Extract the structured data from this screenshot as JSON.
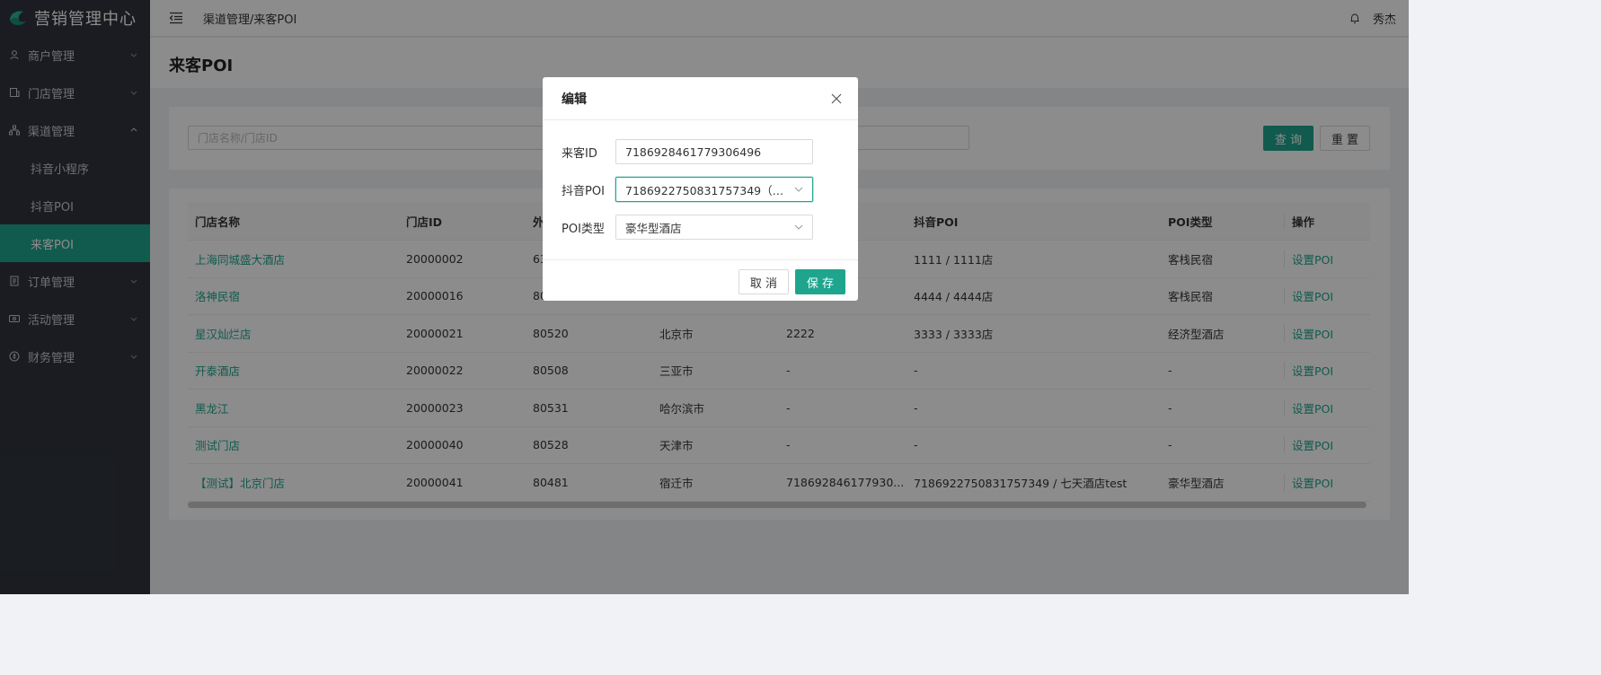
{
  "app": {
    "title": "营销管理中心",
    "brand_color": "#1fa58e"
  },
  "sidebar": {
    "items": [
      {
        "label": "商户管理",
        "icon": "user-icon",
        "expanded": false
      },
      {
        "label": "门店管理",
        "icon": "store-icon",
        "expanded": false
      },
      {
        "label": "渠道管理",
        "icon": "channel-icon",
        "expanded": true,
        "children": [
          {
            "label": "抖音小程序",
            "active": false
          },
          {
            "label": "抖音POI",
            "active": false
          },
          {
            "label": "来客POI",
            "active": true
          }
        ]
      },
      {
        "label": "订单管理",
        "icon": "order-icon",
        "expanded": false
      },
      {
        "label": "活动管理",
        "icon": "activity-icon",
        "expanded": false
      },
      {
        "label": "财务管理",
        "icon": "finance-icon",
        "expanded": false
      }
    ]
  },
  "header": {
    "breadcrumb": "渠道管理/来客POI",
    "user": "秀杰"
  },
  "page": {
    "title": "来客POI"
  },
  "filter": {
    "placeholder": "门店名称/门店ID",
    "query_label": "查 询",
    "reset_label": "重 置"
  },
  "table": {
    "headers": [
      "门店名称",
      "门店ID",
      "外",
      "",
      "",
      "抖音POI",
      "POI类型",
      "操作"
    ],
    "rows": [
      [
        "上海同城盛大酒店",
        "20000002",
        "63",
        "",
        "",
        "1111 / 1111店",
        "客栈民宿",
        "设置POI"
      ],
      [
        "洛神民宿",
        "20000016",
        "80",
        "",
        "",
        "4444 / 4444店",
        "客栈民宿",
        "设置POI"
      ],
      [
        "星汉灿烂店",
        "20000021",
        "80520",
        "北京市",
        "2222",
        "3333 / 3333店",
        "经济型酒店",
        "设置POI"
      ],
      [
        "开泰酒店",
        "20000022",
        "80508",
        "三亚市",
        "-",
        "-",
        "-",
        "设置POI"
      ],
      [
        "黑龙江",
        "20000023",
        "80531",
        "哈尔滨市",
        "-",
        "-",
        "-",
        "设置POI"
      ],
      [
        "测试门店",
        "20000040",
        "80528",
        "天津市",
        "-",
        "-",
        "-",
        "设置POI"
      ],
      [
        "【测试】北京门店",
        "20000041",
        "80481",
        "宿迁市",
        "718692846177930...",
        "7186922750831757349 / 七天酒店test",
        "豪华型酒店",
        "设置POI"
      ]
    ]
  },
  "modal": {
    "title": "编辑",
    "fields": {
      "laike_id": {
        "label": "来客ID",
        "value": "7186928461779306496"
      },
      "douyin_poi": {
        "label": "抖音POI",
        "value": "7186922750831757349（七..."
      },
      "poi_type": {
        "label": "POI类型",
        "value": "豪华型酒店"
      }
    },
    "cancel_label": "取 消",
    "save_label": "保 存"
  }
}
